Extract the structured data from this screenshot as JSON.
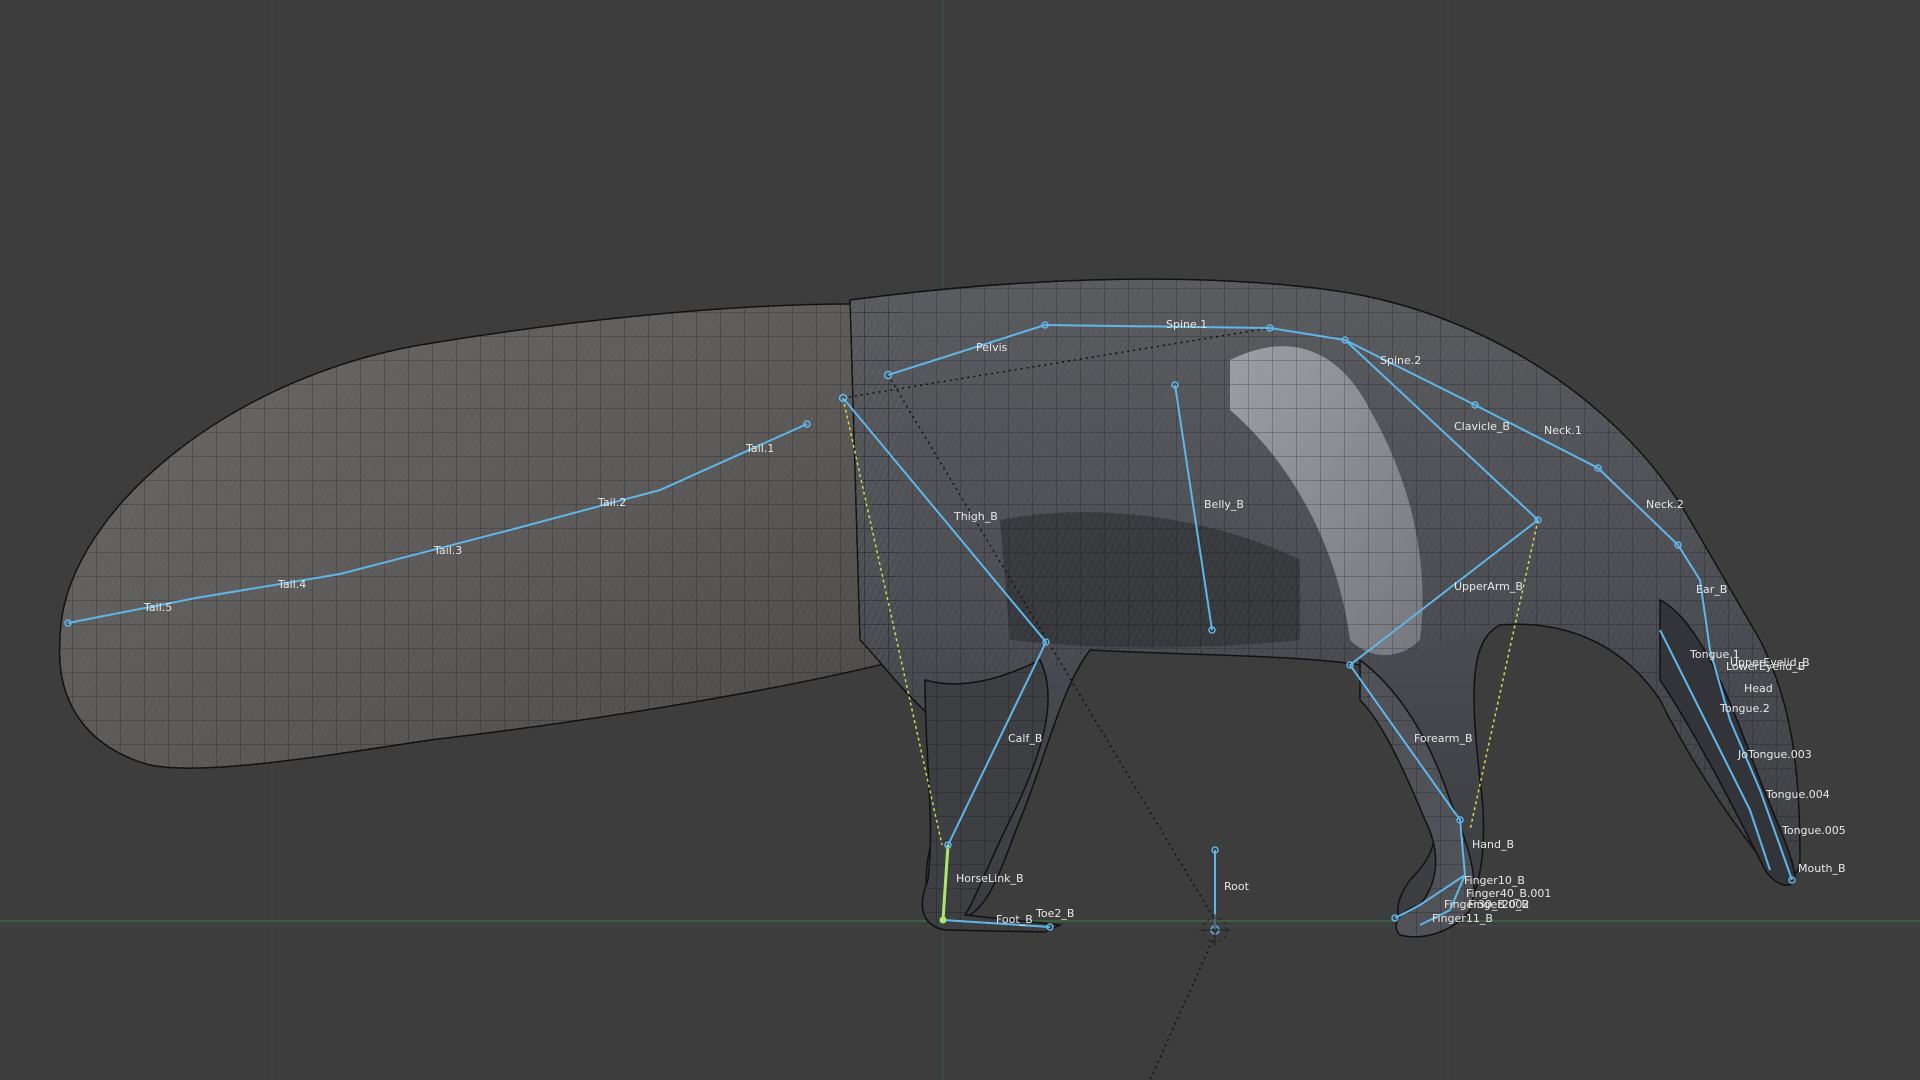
{
  "viewport": {
    "background": "#3d3d3d",
    "grid_color": "#4a4a4a",
    "bone_color": "#5fb6e8",
    "active_bone_color": "#a9e86b",
    "ik_line_color": "#cfd94a",
    "mesh_wire_color": "#111111"
  },
  "bones": {
    "pelvis": "Pelvis",
    "spine1": "Spine.1",
    "spine2": "Spine.2",
    "clavicle": "Clavicle_B",
    "neck1": "Neck.1",
    "neck2": "Neck.2",
    "ear": "Ear_B",
    "tongue1": "Tongue.1",
    "upper_eyelid": "UpperEyelid_B",
    "lower_eyelid": "LowerEyelid_B",
    "head": "Head",
    "tongue2": "Tongue.2",
    "jaw_tongue3": "JoTongue.003",
    "tongue4": "Tongue.004",
    "tongue5": "Tongue.005",
    "mouth": "Mouth_B",
    "tail1": "Tail.1",
    "tail2": "Tail.2",
    "tail3": "Tail.3",
    "tail4": "Tail.4",
    "tail5": "Tail.5",
    "thigh": "Thigh_B",
    "belly": "Belly_B",
    "upperarm": "UpperArm_B",
    "calf": "Calf_B",
    "forearm": "Forearm_B",
    "hand": "Hand_B",
    "horselink": "HorseLink_B",
    "foot": "Foot_B",
    "toe": "Toe2_B",
    "root": "Root",
    "finger10": "Finger10_B",
    "finger_b001": "Finger40_B.001",
    "finger_b002": "Finger30_B.002",
    "finger_b003": "Finger20_B",
    "finger11": "Finger11_B"
  }
}
